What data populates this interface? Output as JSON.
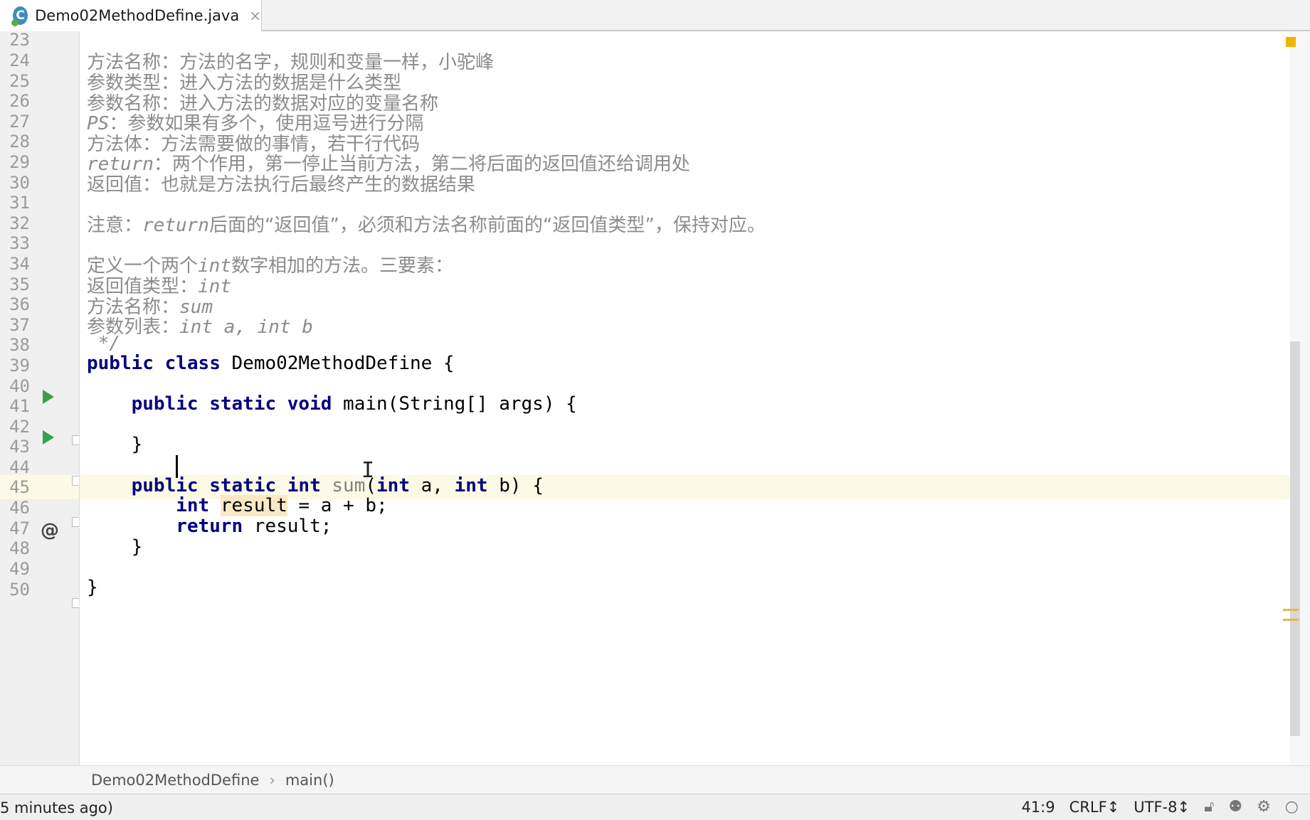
{
  "tab": {
    "filename": "Demo02MethodDefine.java",
    "icon_letter": "C",
    "close": "×"
  },
  "editor": {
    "current_line": "41",
    "lines": [
      {
        "no": "23",
        "text": "方法名称：方法的名字，规则和变量一样，小驼峰"
      },
      {
        "no": "24",
        "text": "参数类型：进入方法的数据是什么类型"
      },
      {
        "no": "25",
        "text": "参数名称：进入方法的数据对应的变量名称"
      },
      {
        "no": "26",
        "pre": "PS",
        "text": "：参数如果有多个，使用逗号进行分隔"
      },
      {
        "no": "27",
        "text": "方法体：方法需要做的事情，若干行代码"
      },
      {
        "no": "28",
        "pre": "return",
        "text": "：两个作用，第一停止当前方法，第二将后面的返回值还给调用处"
      },
      {
        "no": "29",
        "text": "返回值：也就是方法执行后最终产生的数据结果"
      },
      {
        "no": "30",
        "text": ""
      },
      {
        "no": "31",
        "a": "注意：",
        "b": "return",
        "c": "后面的“返回值”，必须和方法名称前面的“返回值类型”，保持对应。"
      },
      {
        "no": "32",
        "text": ""
      },
      {
        "no": "33",
        "a": "定义一个两个",
        "b": "int",
        "c": "数字相加的方法。三要素："
      },
      {
        "no": "34",
        "a": "返回值类型：",
        "b": "int"
      },
      {
        "no": "35",
        "a": "方法名称：",
        "b": "sum"
      },
      {
        "no": "36",
        "a": "参数列表：",
        "b": "int a, int b"
      },
      {
        "no": "37",
        "text": " */"
      },
      {
        "no": "38",
        "kw1": "public",
        "kw2": "class",
        "rest": " Demo02MethodDefine {"
      },
      {
        "no": "39",
        "text": ""
      },
      {
        "no": "40",
        "kw1": "public",
        "kw2": "static",
        "kw3": "void",
        "rest": " main(String[] args) {"
      },
      {
        "no": "41",
        "text": ""
      },
      {
        "no": "42",
        "rest": "    }"
      },
      {
        "no": "43",
        "text": ""
      },
      {
        "no": "44",
        "kw1": "public",
        "kw2": "static",
        "kw3": "int",
        "name": "sum",
        "p1": "(",
        "kw4": "int",
        "p2": " a, ",
        "kw5": "int",
        "p3": " b) {"
      },
      {
        "no": "45",
        "kw1": "int",
        "var": "result",
        "rest": " = a + b;"
      },
      {
        "no": "46",
        "kw1": "return",
        "rest": " result;"
      },
      {
        "no": "47",
        "rest": "    }"
      },
      {
        "no": "48",
        "text": ""
      },
      {
        "no": "49",
        "rest": "}"
      },
      {
        "no": "50",
        "text": ""
      }
    ]
  },
  "breadcrumb": {
    "class": "Demo02MethodDefine",
    "sep": "›",
    "method": "main()"
  },
  "status": {
    "left": "5 minutes ago)",
    "position": "41:9",
    "line_sep": "CRLF↕",
    "encoding": "UTF-8↕"
  },
  "colors": {
    "keyword": "#000080",
    "comment": "#8c8c8c",
    "run": "#3a9e4f",
    "current_line": "#fcfae6",
    "highlight": "#fbe9c5"
  }
}
